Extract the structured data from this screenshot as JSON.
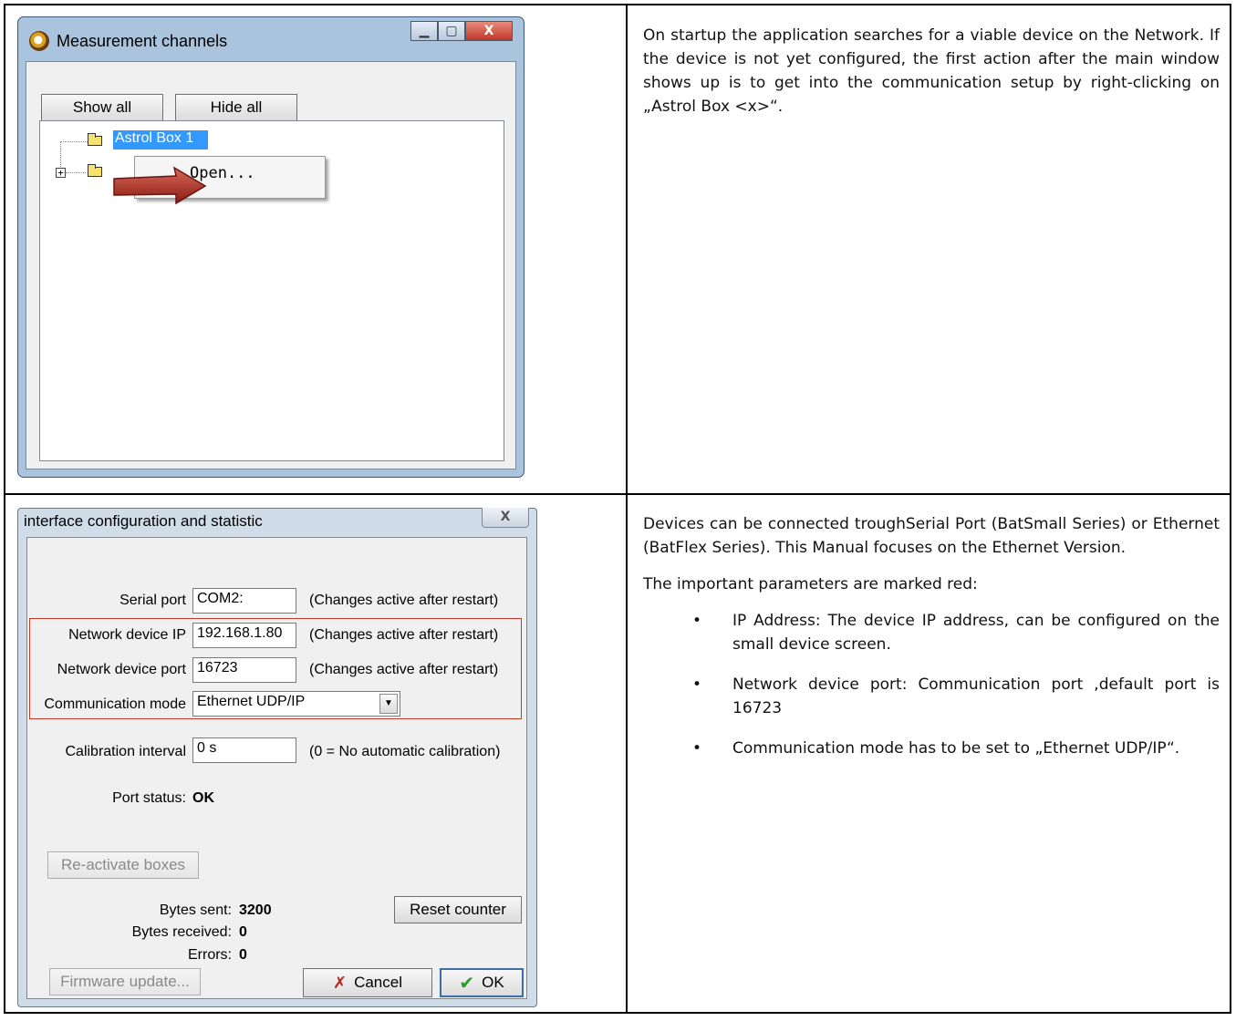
{
  "window1": {
    "title": "Measurement channels",
    "controls": {
      "minimize": "▁",
      "maximize": "▢",
      "close": "X"
    },
    "buttons": {
      "show_all": "Show all",
      "hide_all": "Hide all"
    },
    "tree": {
      "item1_label": "Astrol Box 1",
      "expand_symbol": "+"
    },
    "context_menu": {
      "open": "Open..."
    }
  },
  "window2": {
    "title": "interface configuration and statistic",
    "close": "X",
    "rows": {
      "serial_port": {
        "label": "Serial port",
        "value": "COM2:",
        "note": "(Changes active after restart)"
      },
      "network_ip": {
        "label": "Network device IP",
        "value": "192.168.1.80",
        "note": "(Changes active after restart)"
      },
      "network_port": {
        "label": "Network device port",
        "value": "16723",
        "note": "(Changes active after restart)"
      },
      "comm_mode": {
        "label": "Communication mode",
        "value": "Ethernet UDP/IP"
      },
      "calibration": {
        "label": "Calibration interval",
        "value": "0 s",
        "note": "(0 = No automatic calibration)"
      }
    },
    "port_status": {
      "label": "Port status:",
      "value": "OK"
    },
    "reactivate": "Re-activate boxes",
    "reset_counter": "Reset counter",
    "stats": {
      "bytes_sent": {
        "label": "Bytes sent:",
        "value": "3200"
      },
      "bytes_received": {
        "label": "Bytes received:",
        "value": "0"
      },
      "errors": {
        "label": "Errors:",
        "value": "0"
      }
    },
    "firmware_update": "Firmware update...",
    "cancel": "Cancel",
    "ok": "OK",
    "accent": "#c0392b"
  },
  "text1": {
    "p1": "On startup the application searches for a viable device on the Network. If the device is not yet configured, the first action after the main window shows up is to get into the communication setup by right-clicking on „Astrol Box <x>“."
  },
  "text2": {
    "p1": "Devices can be connected troughSerial Port (BatSmall Series) or Ethernet (BatFlex Series). This Manual focuses on the Ethernet Version.",
    "p2": "The important parameters are marked red:",
    "bullets": [
      "IP Address: The device IP address, can be configured on the small device screen.",
      "Network device port: Communication port ,default port is 16723",
      "Communication mode has to be set to „Ethernet UDP/IP“."
    ]
  }
}
